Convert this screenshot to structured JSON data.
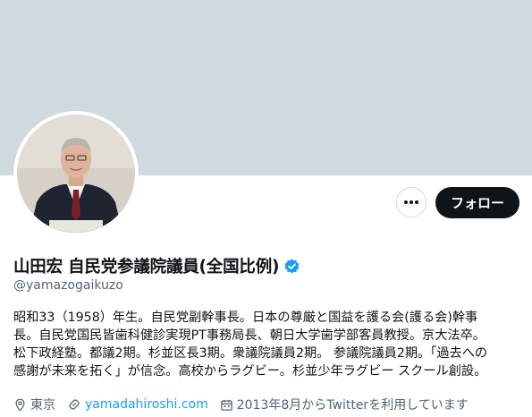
{
  "profile": {
    "name": "山田宏 自民党参議院議員(全国比例)",
    "handle": "@yamazogaikuzo",
    "follow_label": "フォロー",
    "more_label": "•••",
    "verified_icon": "verified-badge-icon",
    "bio_lines": [
      "昭和33（1958）年生。自民党副幹事長。日本の尊厳と国益を護る会(護る会)幹事",
      "長。自民党国民皆歯科健診実現PT事務局長、朝日大学歯学部客員教授。京大法卒。",
      "松下政経塾。都議2期。杉並区長3期。衆議院議員2期。 参議院議員2期。「過去への",
      "感謝が未来を拓く」が信念。高校からラグビー。杉並少年ラグビー スクール創設。"
    ],
    "location": "東京",
    "website": "yamadahiroshi.com",
    "joined": "2013年8月からTwitterを利用しています"
  },
  "colors": {
    "banner": "#cfd9de",
    "follow_bg": "#0f1419",
    "link": "#1d9bf0",
    "verified": "#1d9bf0",
    "secondary_text": "#536471"
  }
}
